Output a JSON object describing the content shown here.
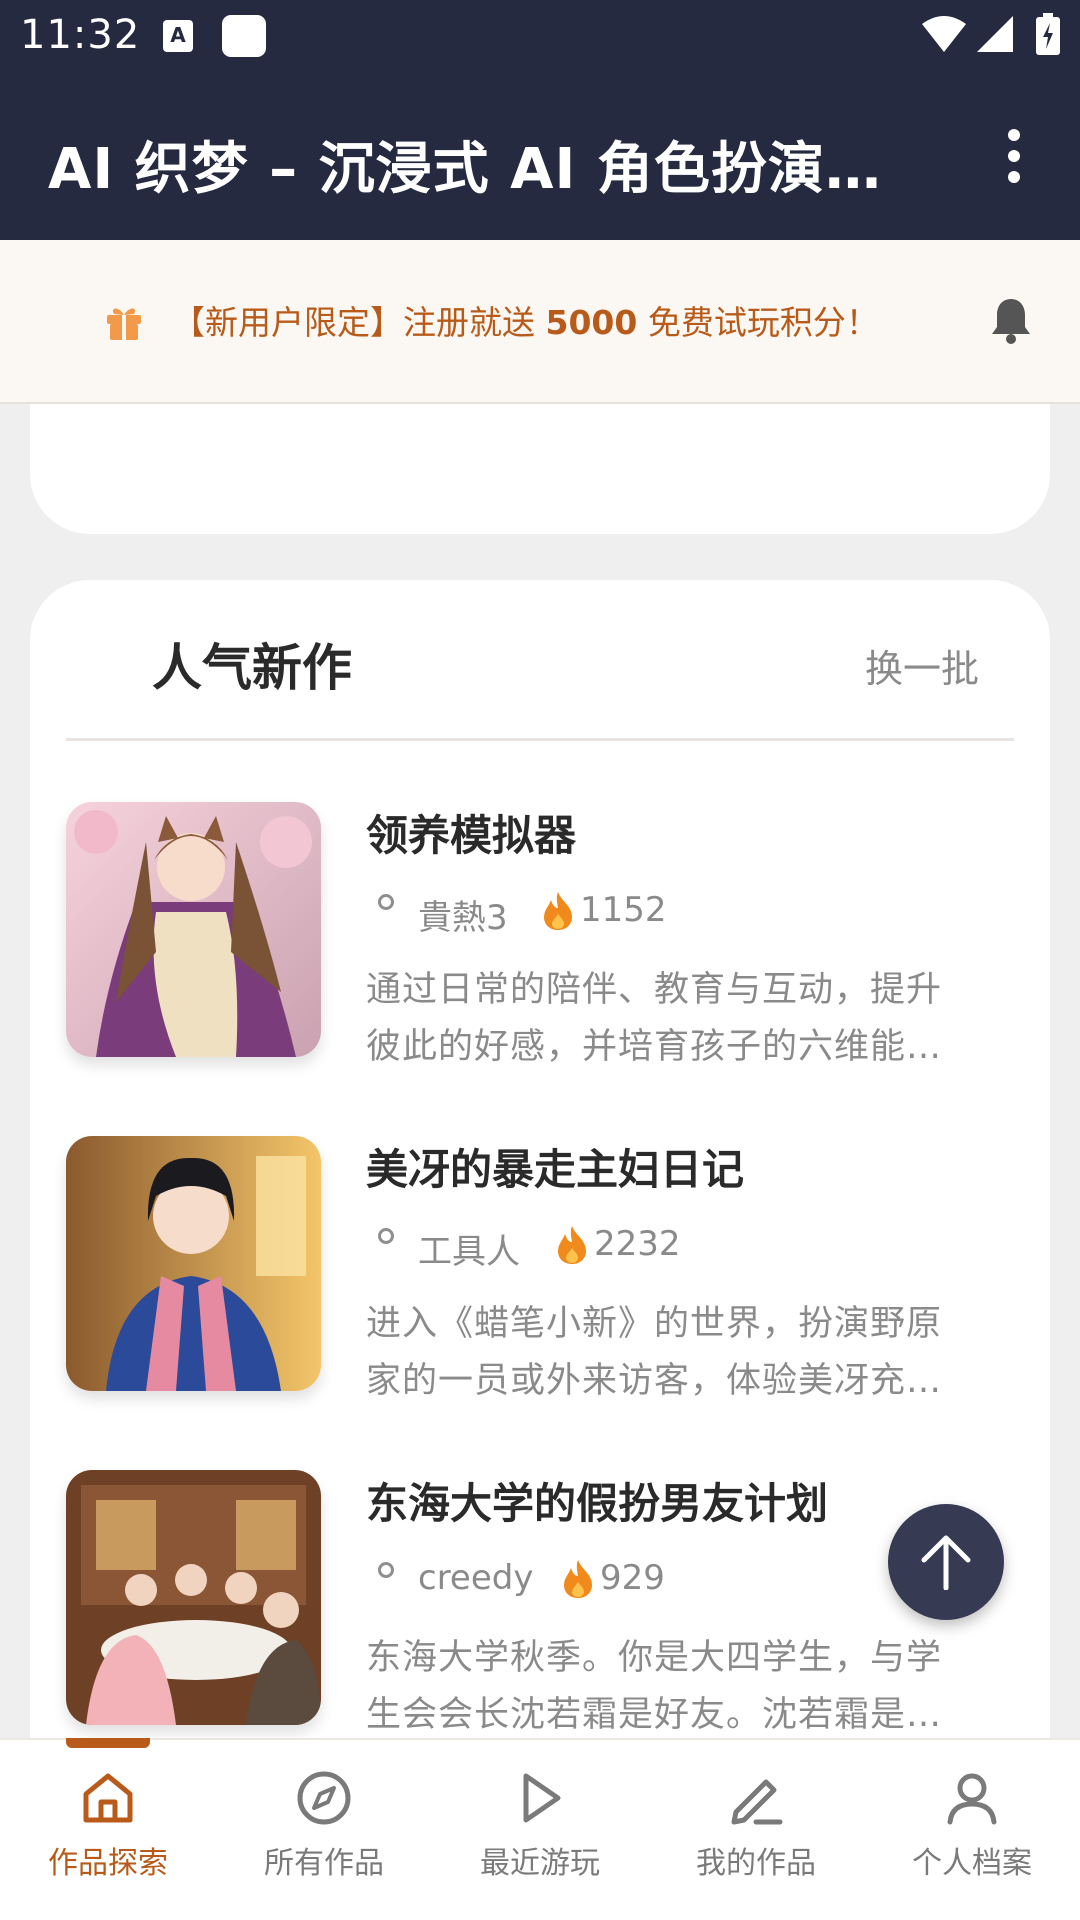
{
  "status_bar": {
    "time": "11:32",
    "a_icon_letter": "A"
  },
  "app_bar": {
    "title": "AI 织梦 – 沉浸式 AI 角色扮演…"
  },
  "promo": {
    "text_prefix": "【新用户限定】注册就送 ",
    "highlight": "5000",
    "text_suffix": " 免费试玩积分！"
  },
  "section": {
    "title": "人气新作",
    "refresh_label": "换一批"
  },
  "works": [
    {
      "title": "领养模拟器",
      "author": "貴熱3",
      "plays": "1152",
      "desc_lines": [
        "通过日常的陪伴、教育与互动，提升",
        "彼此的好感，并培育孩子的六维能…"
      ]
    },
    {
      "title": "美冴的暴走主妇日记",
      "author": "工具人",
      "plays": "2232",
      "desc_lines": [
        "进入《蜡笔小新》的世界，扮演野原",
        "家的一员或外来访客，体验美冴充…"
      ]
    },
    {
      "title": "东海大学的假扮男友计划",
      "author": "creedy",
      "plays": "929",
      "desc_lines": [
        "东海大学秋季。你是大四学生，与学",
        "生会会长沈若霜是好友。沈若霜是…"
      ]
    }
  ],
  "nav": [
    {
      "label": "作品探索",
      "icon": "home-icon",
      "active": true
    },
    {
      "label": "所有作品",
      "icon": "compass-icon",
      "active": false
    },
    {
      "label": "最近游玩",
      "icon": "play-icon",
      "active": false
    },
    {
      "label": "我的作品",
      "icon": "pen-icon",
      "active": false
    },
    {
      "label": "个人档案",
      "icon": "person-icon",
      "active": false
    }
  ],
  "colors": {
    "app_bar": "#262a40",
    "accent": "#b85b1a",
    "fire": "#f08a1c",
    "muted_text": "#8a8a8a"
  }
}
